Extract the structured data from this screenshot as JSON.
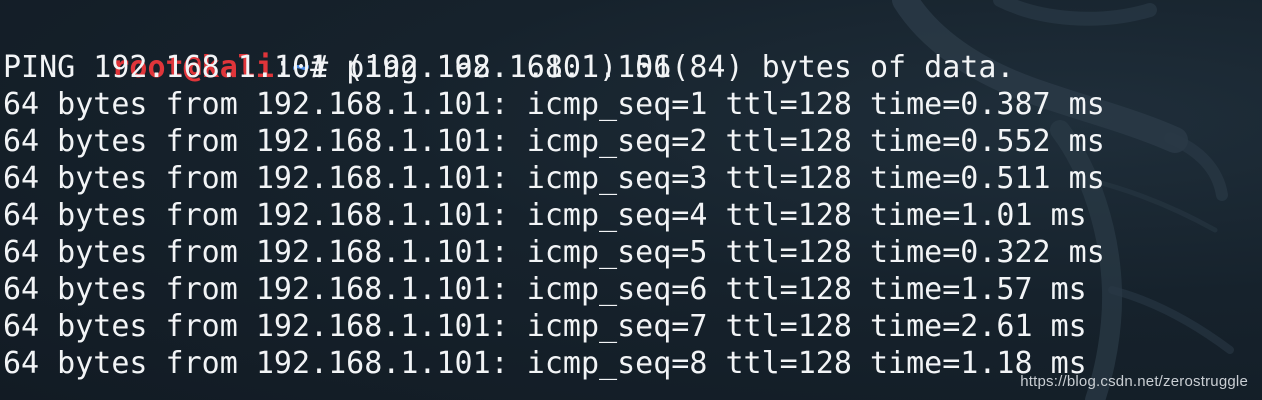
{
  "terminal": {
    "prompt": {
      "user_host": "root@kali",
      "separator": ":",
      "path": "~",
      "symbol": "# ",
      "command": "ping 192.168.1.101"
    },
    "output_lines": [
      "PING 192.168.1.101 (192.168.1.101) 56(84) bytes of data.",
      "64 bytes from 192.168.1.101: icmp_seq=1 ttl=128 time=0.387 ms",
      "64 bytes from 192.168.1.101: icmp_seq=2 ttl=128 time=0.552 ms",
      "64 bytes from 192.168.1.101: icmp_seq=3 ttl=128 time=0.511 ms",
      "64 bytes from 192.168.1.101: icmp_seq=4 ttl=128 time=1.01 ms",
      "64 bytes from 192.168.1.101: icmp_seq=5 ttl=128 time=0.322 ms",
      "64 bytes from 192.168.1.101: icmp_seq=6 ttl=128 time=1.57 ms",
      "64 bytes from 192.168.1.101: icmp_seq=7 ttl=128 time=2.61 ms",
      "64 bytes from 192.168.1.101: icmp_seq=8 ttl=128 time=1.18 ms"
    ],
    "colors": {
      "background": "#15202a",
      "text": "#f2f4f6",
      "prompt_user": "#e0353a",
      "prompt_path": "#4f8fe8"
    }
  },
  "watermark": {
    "text": "https://blog.csdn.net/zerostruggle"
  },
  "background_icon": "kali-dragon-icon"
}
